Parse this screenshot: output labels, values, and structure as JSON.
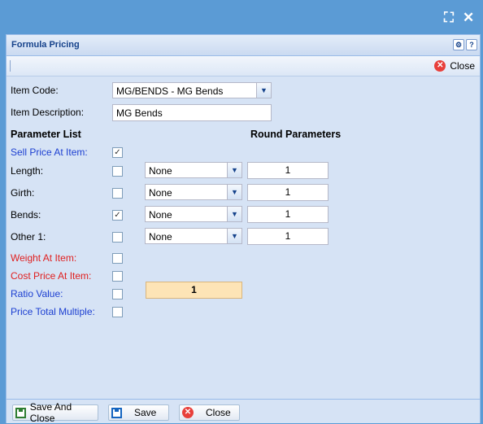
{
  "window": {
    "fullscreen_icon": "⛶",
    "close_icon": "✕"
  },
  "panel": {
    "title": "Formula Pricing",
    "tool_icons": [
      "gear-icon",
      "help-icon"
    ]
  },
  "toolbar": {
    "close_label": "Close"
  },
  "form": {
    "item_code_label": "Item Code:",
    "item_code_value": "MG/BENDS - MG Bends",
    "item_description_label": "Item Description:",
    "item_description_value": "MG Bends",
    "parameter_list_heading": "Parameter List",
    "round_parameters_heading": "Round Parameters",
    "parameters": [
      {
        "label": "Sell Price At Item:",
        "color": "#1c3fd1",
        "checked": true
      },
      {
        "label": "Length:",
        "color": "#000000",
        "checked": false,
        "round": "None",
        "value": "1"
      },
      {
        "label": "Girth:",
        "color": "#000000",
        "checked": false,
        "round": "None",
        "value": "1"
      },
      {
        "label": "Bends:",
        "color": "#000000",
        "checked": true,
        "round": "None",
        "value": "1"
      },
      {
        "label": "Other 1:",
        "color": "#000000",
        "checked": false,
        "round": "None",
        "value": "1"
      },
      {
        "label": "Weight At Item:",
        "color": "#e02020",
        "checked": false
      },
      {
        "label": "Cost Price At Item:",
        "color": "#e02020",
        "checked": false
      },
      {
        "label": "Ratio Value:",
        "color": "#1c3fd1",
        "checked": false
      },
      {
        "label": "Price Total Multiple:",
        "color": "#1c3fd1",
        "checked": false
      }
    ],
    "ratio_value": "1"
  },
  "footer": {
    "save_and_close": "Save And Close",
    "save": "Save",
    "close": "Close"
  }
}
